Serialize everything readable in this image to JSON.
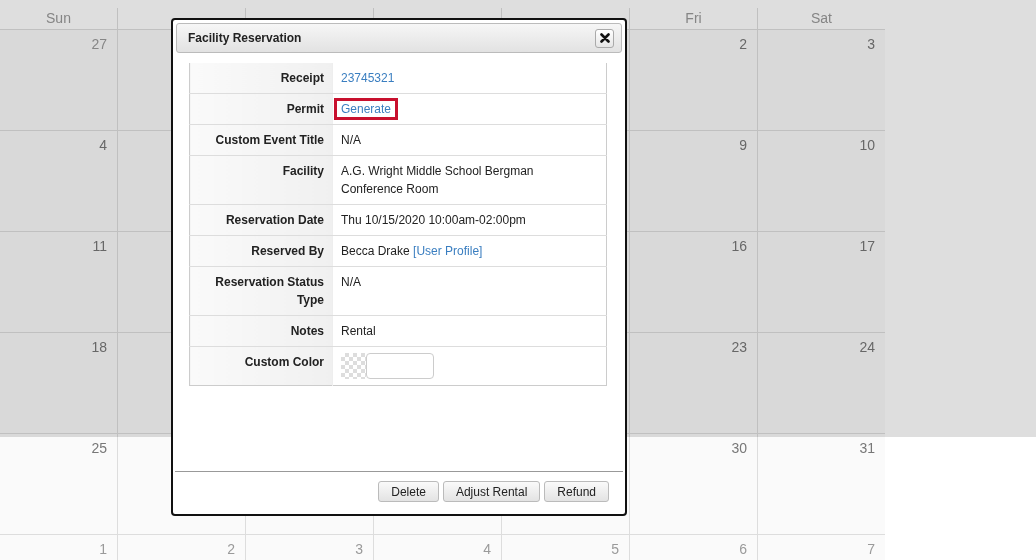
{
  "calendar": {
    "weekdays": {
      "sun": "Sun",
      "fri": "Fri",
      "sat": "Sat"
    },
    "weeks": [
      {
        "sun": {
          "day": "27",
          "other_month": true
        },
        "fri": {
          "day": "2",
          "other_month": false
        },
        "sat": {
          "day": "3",
          "other_month": false
        }
      },
      {
        "sun": {
          "day": "4",
          "other_month": false
        },
        "fri": {
          "day": "9",
          "other_month": false
        },
        "sat": {
          "day": "10",
          "other_month": false
        }
      },
      {
        "sun": {
          "day": "11",
          "other_month": false
        },
        "fri": {
          "day": "16",
          "other_month": false
        },
        "sat": {
          "day": "17",
          "other_month": false
        }
      },
      {
        "sun": {
          "day": "18",
          "other_month": false
        },
        "fri": {
          "day": "23",
          "other_month": false
        },
        "sat": {
          "day": "24",
          "other_month": false
        }
      },
      {
        "sun": {
          "day": "25",
          "other_month": false
        },
        "fri": {
          "day": "30",
          "other_month": false
        },
        "sat": {
          "day": "31",
          "other_month": false
        }
      },
      {
        "sun": {
          "day": "1",
          "other_month": true
        },
        "mon": {
          "day": "2",
          "other_month": true
        },
        "tue": {
          "day": "3",
          "other_month": true
        },
        "wed": {
          "day": "4",
          "other_month": true
        },
        "thu": {
          "day": "5",
          "other_month": true
        },
        "fri": {
          "day": "6",
          "other_month": true
        },
        "sat": {
          "day": "7",
          "other_month": true
        }
      }
    ]
  },
  "dialog": {
    "title": "Facility Reservation",
    "rows": [
      {
        "label": "Receipt",
        "kind": "link",
        "value": "23745321",
        "highlighted": false
      },
      {
        "label": "Permit",
        "kind": "link",
        "value": "Generate",
        "highlighted": true
      },
      {
        "label": "Custom Event Title",
        "kind": "text",
        "value": "N/A"
      },
      {
        "label": "Facility",
        "kind": "text",
        "value": "A.G. Wright Middle School Bergman Conference Room"
      },
      {
        "label": "Reservation Date",
        "kind": "text",
        "value": "Thu 10/15/2020 10:00am-02:00pm"
      },
      {
        "label": "Reserved By",
        "kind": "text_link",
        "value": "Becca Drake",
        "link": "[User Profile]"
      },
      {
        "label": "Reservation Status Type",
        "kind": "text",
        "value": "N/A"
      },
      {
        "label": "Notes",
        "kind": "text",
        "value": "Rental"
      },
      {
        "label": "Custom Color",
        "kind": "color"
      }
    ],
    "buttons": [
      "Delete",
      "Adjust Rental",
      "Refund"
    ]
  }
}
